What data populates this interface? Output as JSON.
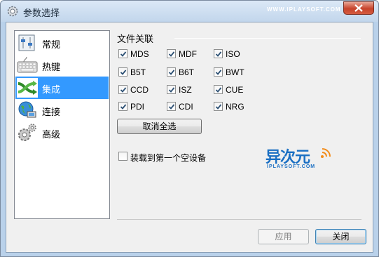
{
  "window": {
    "title": "参数选择",
    "watermark": "WWW.IPLAYSOFT.COM"
  },
  "sidebar": {
    "items": [
      {
        "label": "常规",
        "icon": "general-settings-icon",
        "selected": false
      },
      {
        "label": "热键",
        "icon": "keyboard-icon",
        "selected": false
      },
      {
        "label": "集成",
        "icon": "integration-arrows-icon",
        "selected": true
      },
      {
        "label": "连接",
        "icon": "network-globe-icon",
        "selected": false
      },
      {
        "label": "高级",
        "icon": "gears-icon",
        "selected": false
      }
    ]
  },
  "file_assoc": {
    "title": "文件关联",
    "types": [
      {
        "label": "MDS",
        "checked": true
      },
      {
        "label": "MDF",
        "checked": true
      },
      {
        "label": "ISO",
        "checked": true
      },
      {
        "label": "B5T",
        "checked": true
      },
      {
        "label": "B6T",
        "checked": true
      },
      {
        "label": "BWT",
        "checked": true
      },
      {
        "label": "CCD",
        "checked": true
      },
      {
        "label": "ISZ",
        "checked": true
      },
      {
        "label": "CUE",
        "checked": true
      },
      {
        "label": "PDI",
        "checked": true
      },
      {
        "label": "CDI",
        "checked": true
      },
      {
        "label": "NRG",
        "checked": true
      }
    ],
    "deselect_all_label": "取消全选"
  },
  "mount_option": {
    "label": "装载到第一个空设备",
    "checked": false
  },
  "logo": {
    "text": "异次元",
    "sub": "IPLAYSOFT.COM"
  },
  "buttons": {
    "apply": "应用",
    "close": "关闭"
  },
  "colors": {
    "selection": "#3399ff",
    "close_button": "#c7432b",
    "logo": "#1a6fc3"
  }
}
